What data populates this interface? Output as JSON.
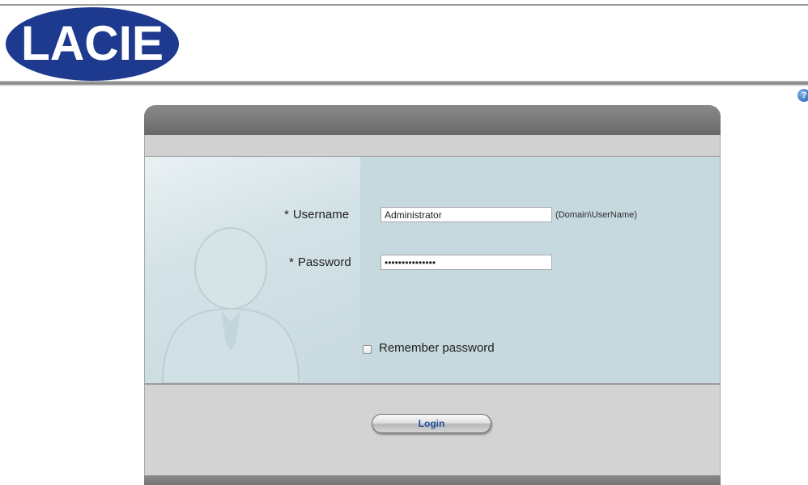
{
  "brand": {
    "logo_text": "LACIE",
    "logo_color": "#1e3a8f"
  },
  "header": {
    "help_icon": "help-icon",
    "help_glyph": "?"
  },
  "form": {
    "required_marker": "*",
    "username_label": "Username",
    "username_value": "Administrator",
    "username_hint": "(Domain\\UserName)",
    "password_label": "Password",
    "password_value": "secretpassword1",
    "remember_label": "Remember password",
    "remember_checked": false,
    "login_label": "Login"
  },
  "colors": {
    "panel_body": "#c6d9df",
    "panel_frame": "#777777",
    "login_text": "#1d4f9c"
  }
}
